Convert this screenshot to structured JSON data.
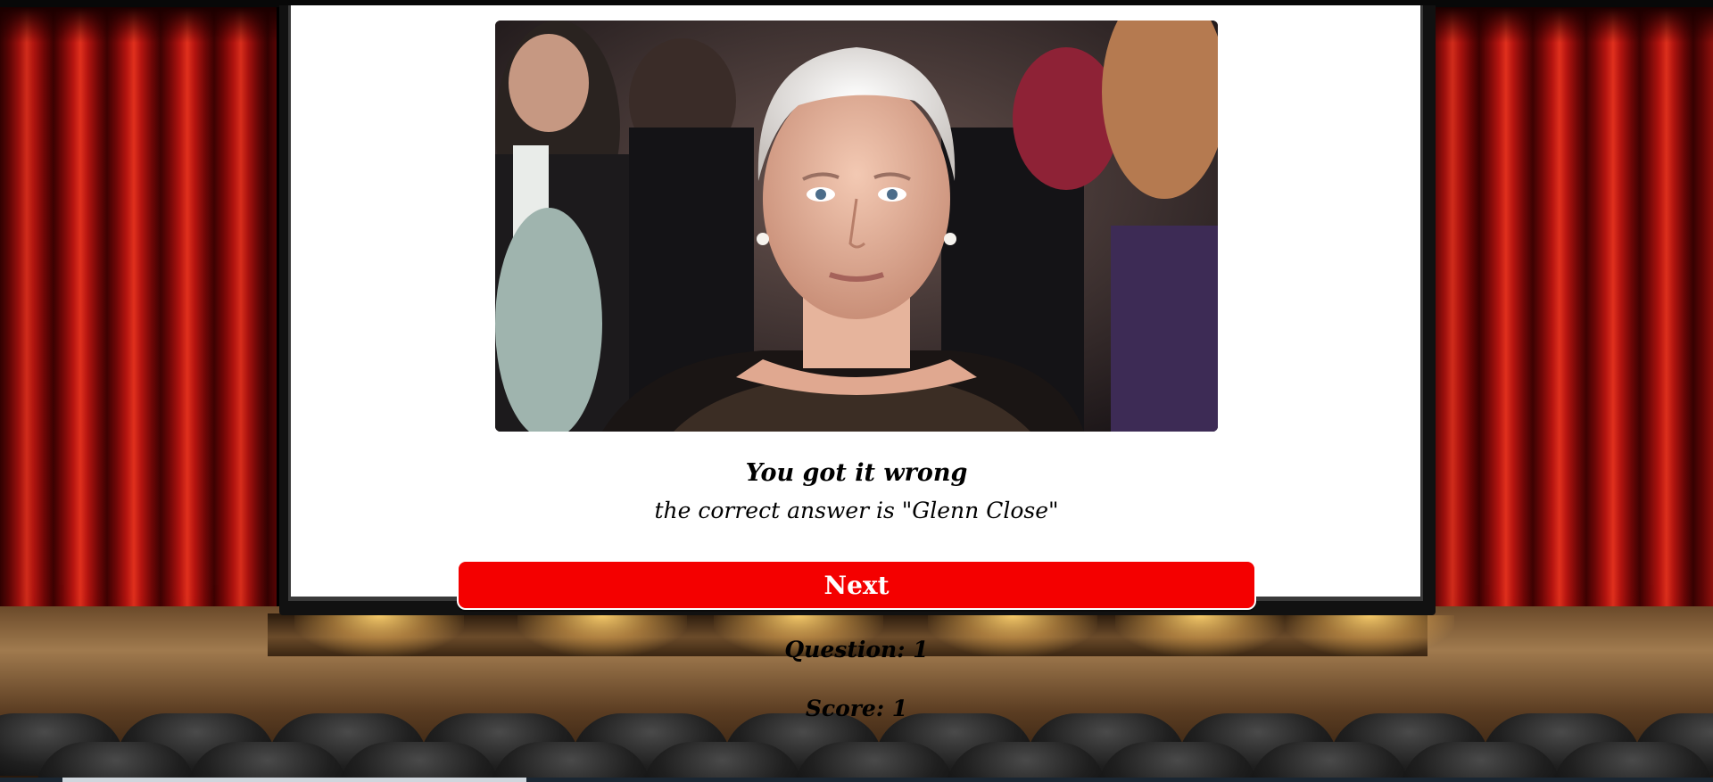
{
  "quiz": {
    "result_heading": "You got it wrong",
    "answer_text": "the correct answer is \"Glenn Close\"",
    "next_label": "Next",
    "question_label": "Question: 1",
    "score_label": "Score: 1"
  },
  "colors": {
    "next_button": "#f40000",
    "curtain": "#b51510",
    "screen": "#ffffff"
  }
}
